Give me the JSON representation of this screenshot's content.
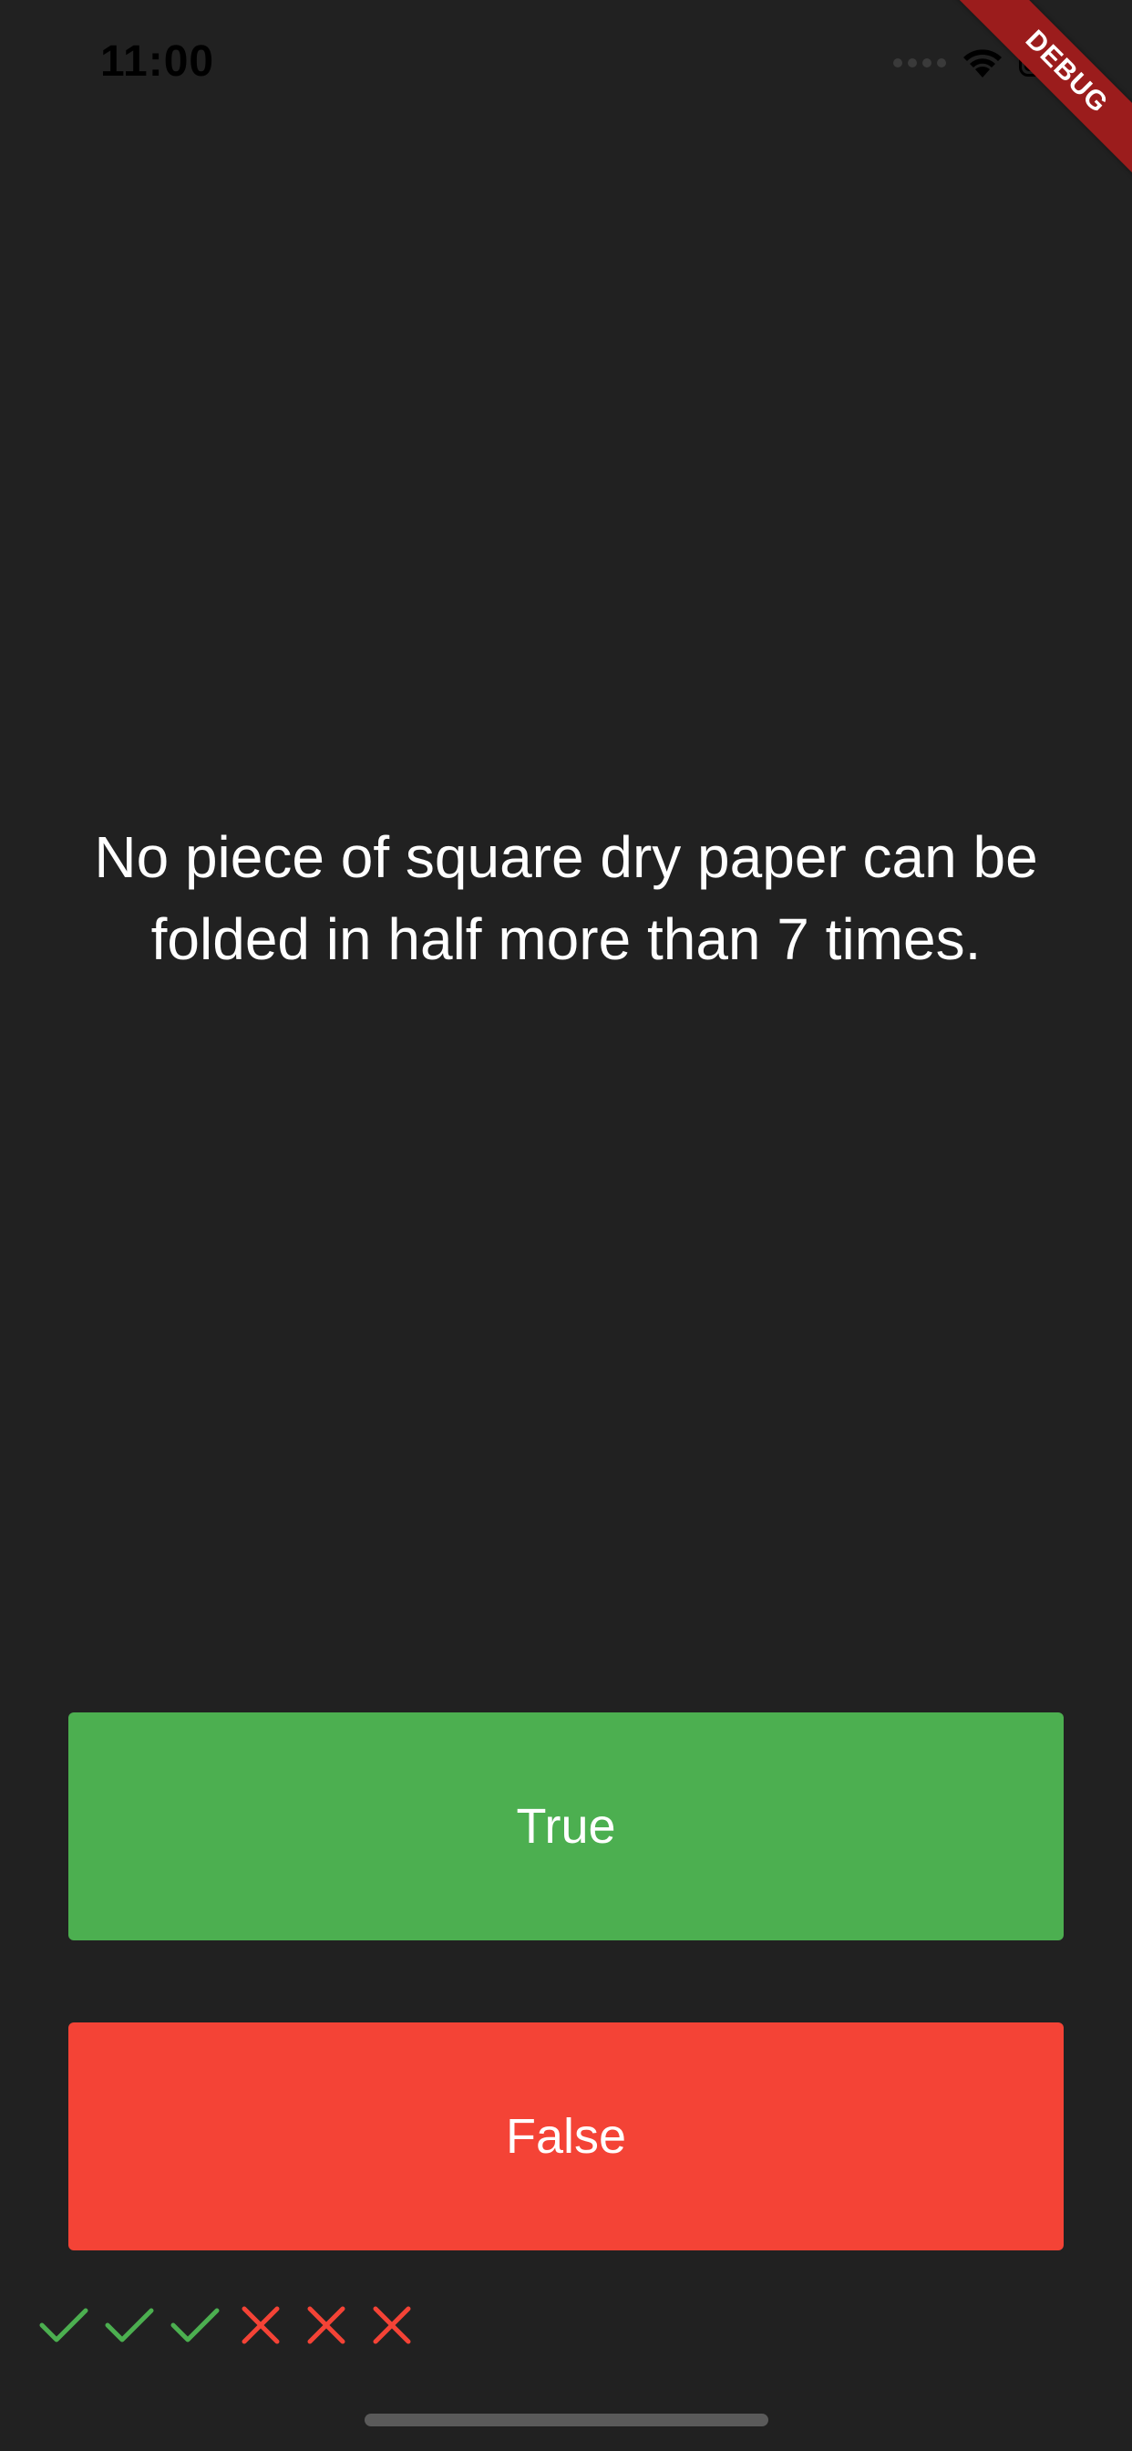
{
  "status_bar": {
    "time": "11:00",
    "signal_icon": "cellular-signal-icon",
    "wifi_icon": "wifi-icon",
    "battery_icon": "battery-icon",
    "battery_level": 1.0
  },
  "debug_banner": {
    "label": "DEBUG"
  },
  "quiz": {
    "question": "No piece of square dry paper can be folded in half more than 7 times.",
    "true_label": "True",
    "false_label": "False"
  },
  "score_keeper": {
    "results": [
      "correct",
      "correct",
      "correct",
      "incorrect",
      "incorrect",
      "incorrect"
    ],
    "correct_icon": "check-icon",
    "incorrect_icon": "close-icon",
    "correct_color": "#4CAF50",
    "incorrect_color": "#F44336"
  },
  "colors": {
    "background": "#212121",
    "true_button": "#4CAF50",
    "false_button": "#F44336",
    "debug_banner": "#9b1c1c"
  }
}
